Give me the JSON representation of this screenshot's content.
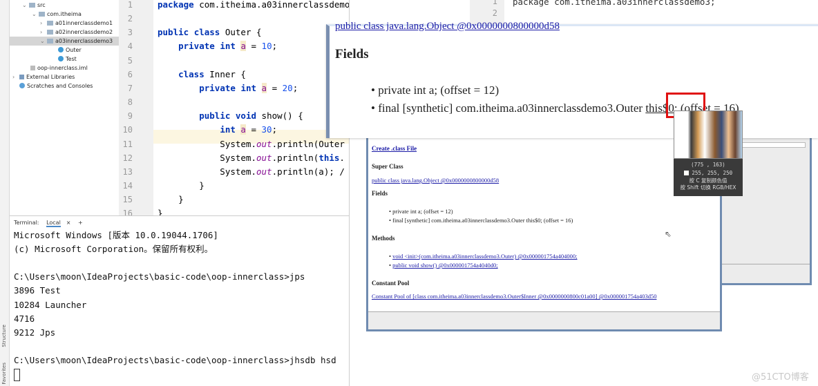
{
  "project_tree": [
    {
      "label": "src",
      "type": "source-folder",
      "expanded": true
    },
    {
      "label": "com.itheima",
      "type": "package",
      "expanded": true
    },
    {
      "label": "a01innerclassdemo1",
      "type": "package",
      "expanded": false
    },
    {
      "label": "a02innerclassdemo2",
      "type": "package",
      "expanded": false
    },
    {
      "label": "a03innerclassdemo3",
      "type": "package",
      "expanded": true,
      "selected": true
    },
    {
      "label": "Outer",
      "type": "class"
    },
    {
      "label": "Test",
      "type": "class"
    },
    {
      "label": "oop-innerclass.iml",
      "type": "file"
    },
    {
      "label": "External Libraries",
      "type": "libraries"
    },
    {
      "label": "Scratches and Consoles",
      "type": "scratches"
    }
  ],
  "side_tabs": {
    "structure": "Structure",
    "favorites": "Favorites"
  },
  "editor": {
    "line_numbers": [
      "1",
      "2",
      "3",
      "4",
      "5",
      "6",
      "7",
      "8",
      "9",
      "10",
      "11",
      "12",
      "13",
      "14",
      "15",
      "16"
    ],
    "lines": [
      "package com.itheima.a03innerclassdemo3;",
      "",
      "public class Outer {",
      "    private int a = 10;",
      "",
      "    class Inner {",
      "        private int a = 20;",
      "",
      "        public void show() {",
      "            int a = 30;",
      "            System.out.println(Outer",
      "            System.out.println(this.",
      "            System.out.println(a); /",
      "        }",
      "    }",
      "}"
    ]
  },
  "terminal": {
    "label": "Terminal:",
    "tab": "Local",
    "add": "+",
    "lines": [
      "Microsoft Windows [版本 10.0.19044.1706]",
      "(c) Microsoft Corporation。保留所有权利。",
      "",
      "C:\\Users\\moon\\IdeaProjects\\basic-code\\oop-innerclass>jps",
      "3896 Test",
      "10284 Launcher",
      "4716",
      "9212 Jps",
      "",
      "C:\\Users\\moon\\IdeaProjects\\basic-code\\oop-innerclass>jhsdb hsd"
    ]
  },
  "editor2": {
    "line_numbers": [
      "1",
      "2"
    ],
    "line1": "package com.itheima.a03innerclassdemo3;"
  },
  "popup": {
    "top_link": "public class java.lang.Object @0x0000000800000d58",
    "heading": "Fields",
    "fields": [
      "private int a; (offset = 12)"
    ],
    "field2_prefix": "final [synthetic] com.itheima.a03innerclassdemo3.Outer ",
    "field2_highlight": "this$0;",
    "field2_suffix": " (offset = 16)"
  },
  "dialog": {
    "create_link": "Create .class File",
    "super_heading": "Super Class",
    "super_link": "public class java.lang.Object @0x0000000800000d58",
    "fields_heading": "Fields",
    "fields": [
      "private int a; (offset = 12)",
      "final [synthetic] com.itheima.a03innerclassdemo3.Outer this$0; (offset = 16)"
    ],
    "methods_heading": "Methods",
    "methods": [
      "void <init>(com.itheima.a03innerclassdemo3.Outer) @0x000001754a404000;",
      "public void show() @0x000001754a4040d0;"
    ],
    "pool_heading": "Constant Pool",
    "pool_link": "Constant Pool of [class com.itheima.a03innerclassdemo3.Outer$Inner @0x0000000800c01a00] @0x000001754a403d50"
  },
  "color_picker": {
    "coords": "(775 , 163)",
    "rgb": "255, 255, 250",
    "hint_copy": "按 C 复制颜色值",
    "hint_switch": "按 Shift 切换 RGB/HEX"
  },
  "watermark": "@51CTO博客",
  "colors": {
    "keyword": "#0033b3",
    "number": "#1750eb",
    "field": "#871094",
    "link": "#1a1aa6",
    "highlight_box": "#e01010",
    "window_border": "#6f8bb0"
  }
}
